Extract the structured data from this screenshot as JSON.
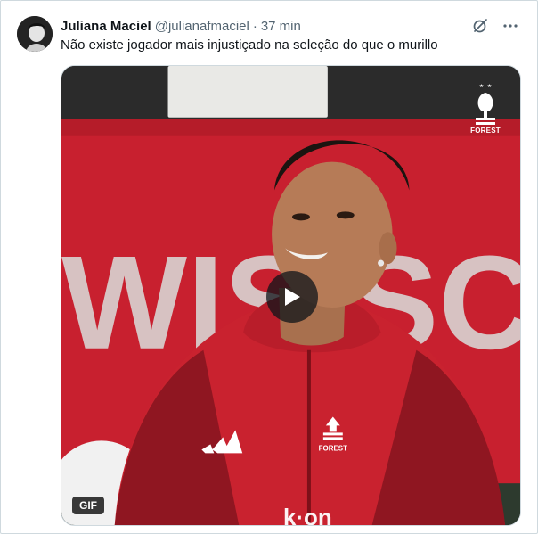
{
  "tweet": {
    "author_name": "Juliana Maciel",
    "author_handle": "@julianafmaciel",
    "separator": "·",
    "timestamp": "37 min",
    "text": "Não existe jogador mais injustiçado na seleção do que o murillo"
  },
  "media": {
    "badge": "GIF",
    "banner_text": "WIS   SC",
    "crest_label": "FOREST",
    "jacket_logo_label": "FOREST"
  },
  "icons": {
    "grok": "grok-icon",
    "more": "more-icon",
    "play": "play-icon"
  },
  "colors": {
    "banner_red": "#c8202f",
    "jacket_red": "#c9222f",
    "text_secondary": "#536471"
  }
}
